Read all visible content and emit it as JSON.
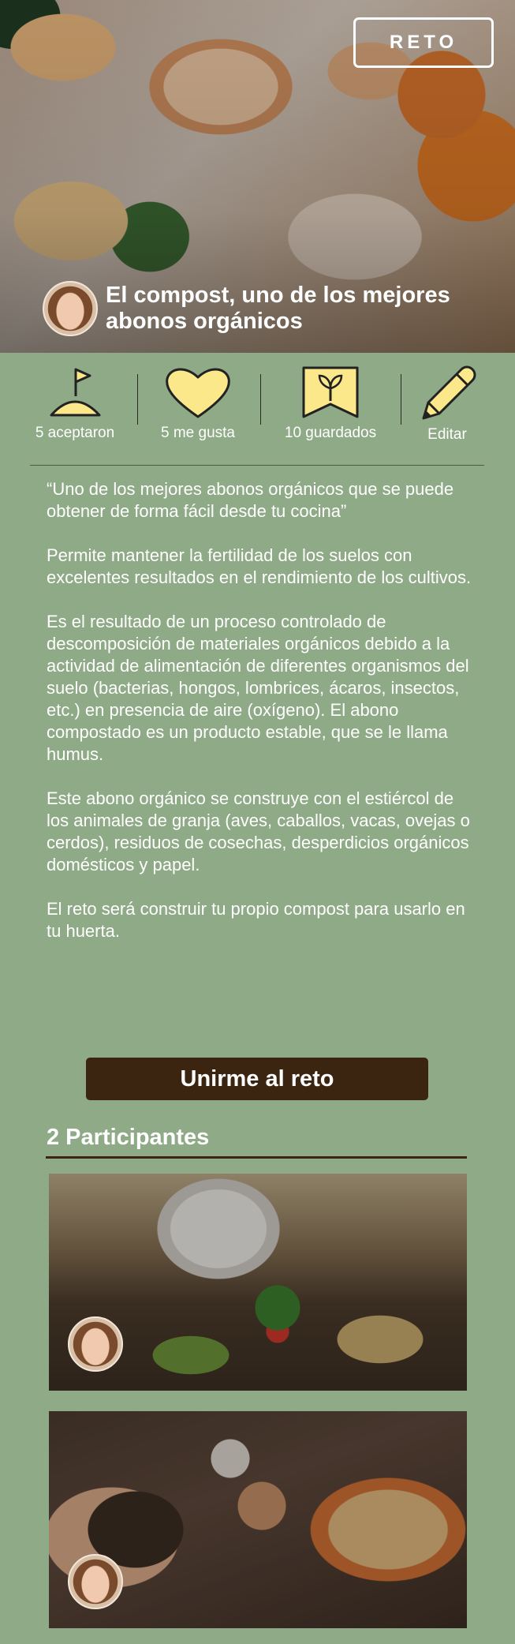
{
  "header": {
    "badge": "RETO",
    "title": "El compost, uno de los mejores abonos orgánicos"
  },
  "stats": [
    {
      "label": "5 aceptaron",
      "icon": "flag-hill-icon"
    },
    {
      "label": "5 me gusta",
      "icon": "heart-icon"
    },
    {
      "label": "10 guardados",
      "icon": "bookmark-sprout-icon"
    },
    {
      "label": "Editar",
      "icon": "pencil-icon"
    }
  ],
  "description": [
    "“Uno de los mejores abonos orgánicos que se puede obtener de forma fácil desde tu cocina”",
    "Permite mantener la fertilidad de los suelos con excelentes resultados en el rendimiento de los cultivos.",
    "Es el resultado de un proceso controlado de descomposición de materiales orgánicos debido a la actividad de alimentación de diferentes organismos del suelo (bacterias, hongos, lombrices, ácaros, insectos, etc.) en presencia de aire (oxígeno). El abono compostado es un producto estable, que se le llama humus.",
    "Este abono orgánico se construye con el estiércol de los animales de granja (aves, caballos, vacas, ovejas o cerdos), residuos de cosechas, desperdicios orgánicos domésticos y papel.",
    "El reto será construir tu propio compost para usarlo en tu huerta."
  ],
  "join_button": "Unirme al reto",
  "participants": {
    "title": "2 Participantes"
  },
  "colors": {
    "background": "#8faa86",
    "button": "#3b2410",
    "icon_fill": "#fbe88a"
  }
}
